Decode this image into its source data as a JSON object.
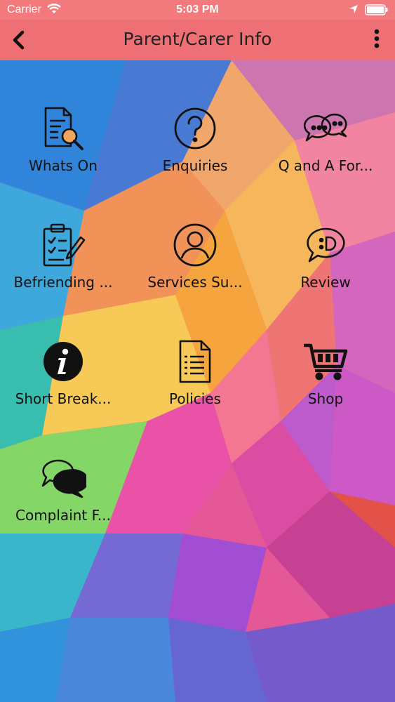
{
  "status_bar": {
    "carrier": "Carrier",
    "time": "5:03 PM"
  },
  "nav": {
    "title": "Parent/Carer Info",
    "back_icon": "chevron-left-icon",
    "menu_icon": "more-vertical-icon"
  },
  "tiles": [
    {
      "label": "Whats On",
      "icon": "document-search-icon"
    },
    {
      "label": "Enquiries",
      "icon": "question-circle-icon"
    },
    {
      "label": "Q and A For...",
      "icon": "chat-bubbles-icon"
    },
    {
      "label": "Befriending ...",
      "icon": "clipboard-check-icon"
    },
    {
      "label": "Services Su...",
      "icon": "user-circle-icon"
    },
    {
      "label": "Review",
      "icon": "smiley-bubble-icon"
    },
    {
      "label": "Short Break...",
      "icon": "info-circle-icon"
    },
    {
      "label": "Policies",
      "icon": "document-list-icon"
    },
    {
      "label": "Shop",
      "icon": "cart-icon"
    },
    {
      "label": "Complaint F...",
      "icon": "conversation-icon"
    }
  ],
  "colors": {
    "status_bar_bg": "#f2797c",
    "nav_bar_bg": "#ee6f74",
    "icon_color": "#111111"
  }
}
